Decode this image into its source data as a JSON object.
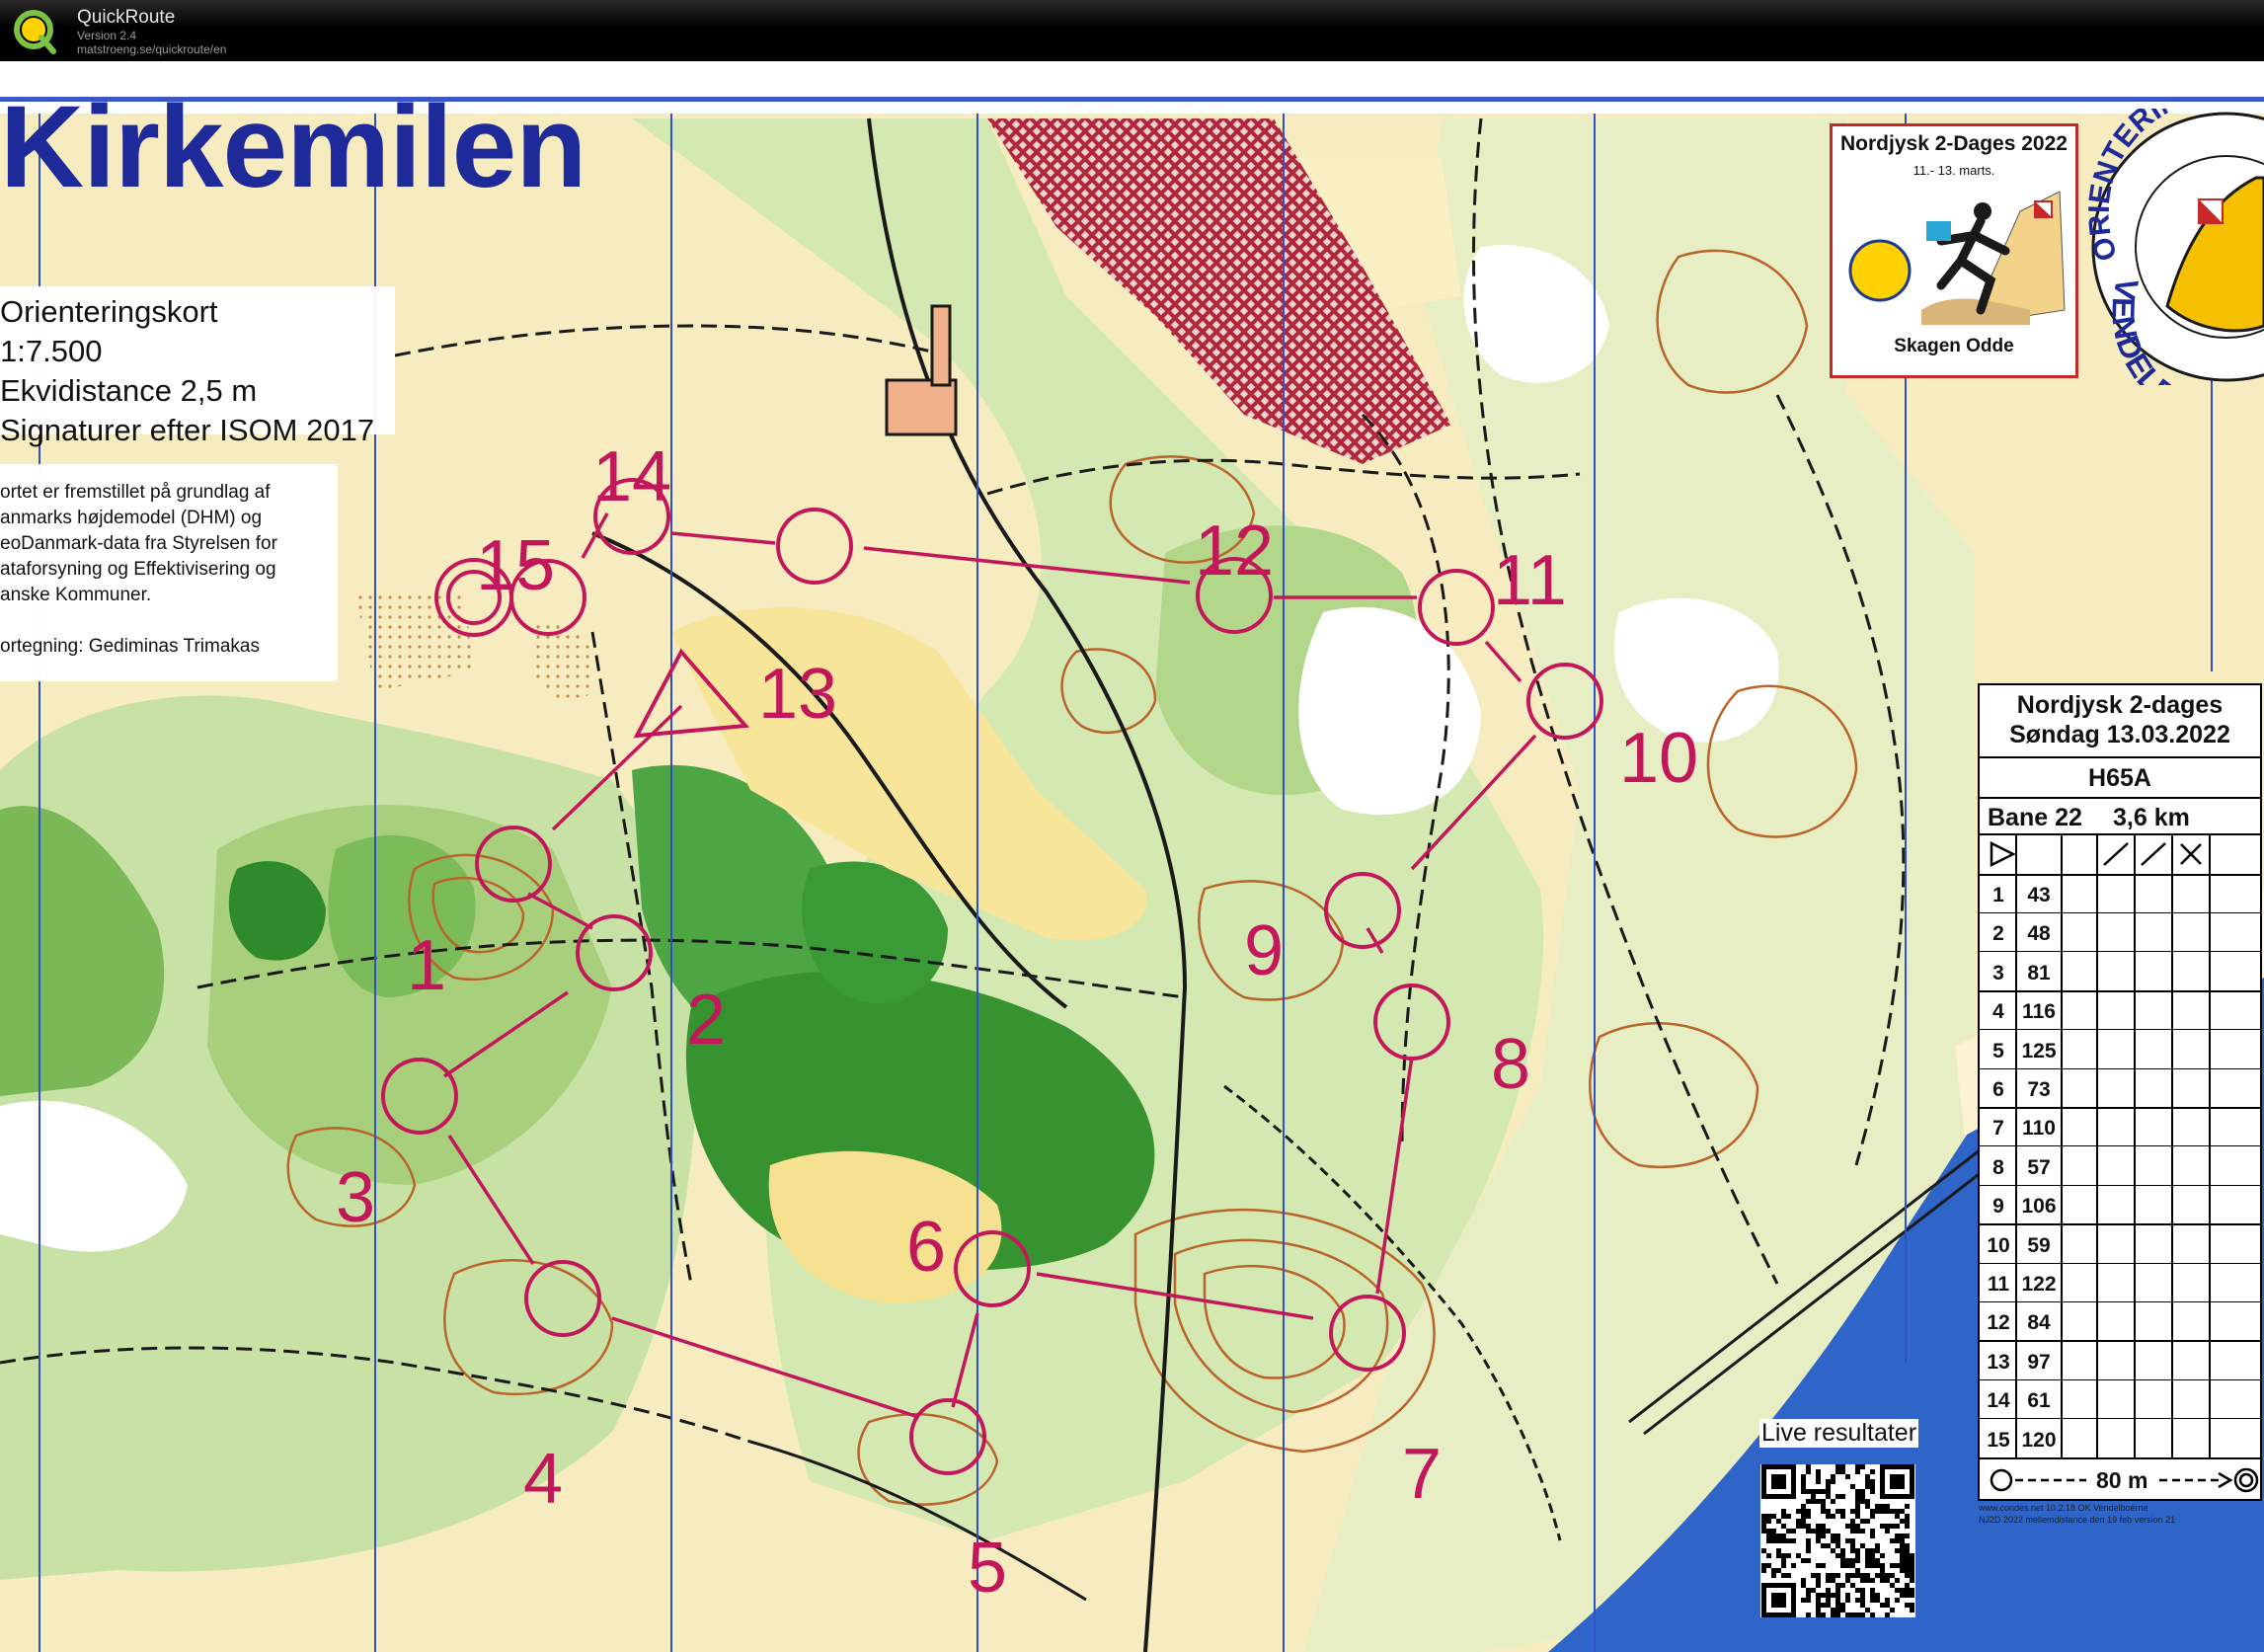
{
  "app": {
    "name": "QuickRoute",
    "version": "Version 2.4",
    "url": "matstroeng.se/quickroute/en",
    "logo_icon": "quickroute-q-icon"
  },
  "map": {
    "title": "Kirkemilen",
    "info_lines": [
      "Orienteringskort",
      "1:7.500",
      "Ekvidistance 2,5 m",
      "Signaturer efter ISOM 2017"
    ],
    "credits_lines": [
      "ortet er fremstillet på grundlag af",
      "anmarks højdemodel (DHM) og",
      "eoDanmark-data fra Styrelsen for",
      "ataforsyning og Effektivisering og",
      "anske Kommuner.",
      "",
      "ortegning: Gediminas Trimakas"
    ],
    "course_color": "#c2185b",
    "water_color": "#2f64c8",
    "forest_colors": [
      "#c5e0a4",
      "#8fc46a",
      "#3e9a3c"
    ],
    "open_color": "#f3e3a2",
    "contour_color": "#b8642a",
    "grid_color": "#3050c8",
    "control_labels": [
      "1",
      "2",
      "3",
      "4",
      "5",
      "6",
      "7",
      "8",
      "9",
      "10",
      "11",
      "12",
      "13",
      "14",
      "15"
    ]
  },
  "event_logo": {
    "title": "Nordjysk 2-Dages 2022",
    "dates": "11.- 13. marts.",
    "place": "Skagen Odde"
  },
  "club_logo": {
    "text_top": "ORIENTERINGSK",
    "text_bottom": "VENDELBOR"
  },
  "live": {
    "label": "Live resultater"
  },
  "footnotes": [
    "www.condes.net 10.2.18 OK Vendelboerne",
    "NJ2D 2022 mellemdistance den 19 feb version 21"
  ],
  "description_sheet": {
    "event": "Nordjysk 2-dages",
    "date_line": "Søndag 13.03.2022",
    "class": "H65A",
    "course": "Bane 22",
    "length": "3,6 km",
    "footer_distance": "80 m",
    "rows": [
      {
        "num": "1",
        "code": "43"
      },
      {
        "num": "2",
        "code": "48"
      },
      {
        "num": "3",
        "code": "81"
      },
      {
        "num": "4",
        "code": "116"
      },
      {
        "num": "5",
        "code": "125"
      },
      {
        "num": "6",
        "code": "73"
      },
      {
        "num": "7",
        "code": "110"
      },
      {
        "num": "8",
        "code": "57"
      },
      {
        "num": "9",
        "code": "106"
      },
      {
        "num": "10",
        "code": "59"
      },
      {
        "num": "11",
        "code": "122"
      },
      {
        "num": "12",
        "code": "84"
      },
      {
        "num": "13",
        "code": "97"
      },
      {
        "num": "14",
        "code": "61"
      },
      {
        "num": "15",
        "code": "120"
      }
    ]
  }
}
